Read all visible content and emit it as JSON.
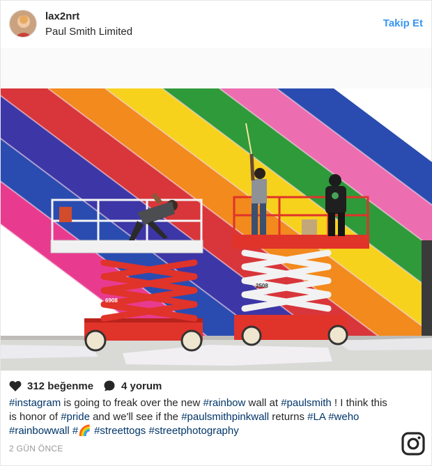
{
  "post": {
    "username": "lax2nrt",
    "location": "Paul Smith Limited",
    "follow_label": "Takip Et",
    "likes_label": "312 beğenme",
    "comments_label": "4 yorum",
    "caption": [
      {
        "text": "#instagram",
        "tag": true
      },
      {
        "text": " is going to freak over the new ",
        "tag": false
      },
      {
        "text": "#rainbow",
        "tag": true
      },
      {
        "text": " wall at ",
        "tag": false
      },
      {
        "text": "#paulsmith",
        "tag": true
      },
      {
        "text": " ! I think this is honor of ",
        "tag": false
      },
      {
        "text": "#pride",
        "tag": true
      },
      {
        "text": " and we'll see if the ",
        "tag": false
      },
      {
        "text": "#paulsmithpinkwall",
        "tag": true
      },
      {
        "text": " returns ",
        "tag": false
      },
      {
        "text": "#LA",
        "tag": true
      },
      {
        "text": " ",
        "tag": false
      },
      {
        "text": "#weho",
        "tag": true
      },
      {
        "text": " ",
        "tag": false
      },
      {
        "text": "#rainbowwall",
        "tag": true
      },
      {
        "text": " ",
        "tag": false
      },
      {
        "text": "#🌈",
        "tag": true
      },
      {
        "text": " ",
        "tag": false
      },
      {
        "text": "#streettogs",
        "tag": true
      },
      {
        "text": " ",
        "tag": false
      },
      {
        "text": "#streetphotography",
        "tag": true
      }
    ],
    "time_ago": "2 GÜN ÖNCE",
    "lift_labels": [
      "6908",
      "2508"
    ]
  },
  "icons": {
    "like": "heart-icon",
    "comment": "comment-bubble-icon",
    "brand": "instagram-logo-icon"
  },
  "colors": {
    "link": "#3897f0",
    "hashtag": "#003569",
    "text": "#262626",
    "muted": "#999999",
    "stripes": [
      "#e83b8f",
      "#2a4cb0",
      "#3d36a6",
      "#d8363a",
      "#f28a1d",
      "#f6d21c",
      "#2f9a3a",
      "#ec6db0",
      "#2a4cb0"
    ],
    "lift_red": "#e0332a"
  }
}
